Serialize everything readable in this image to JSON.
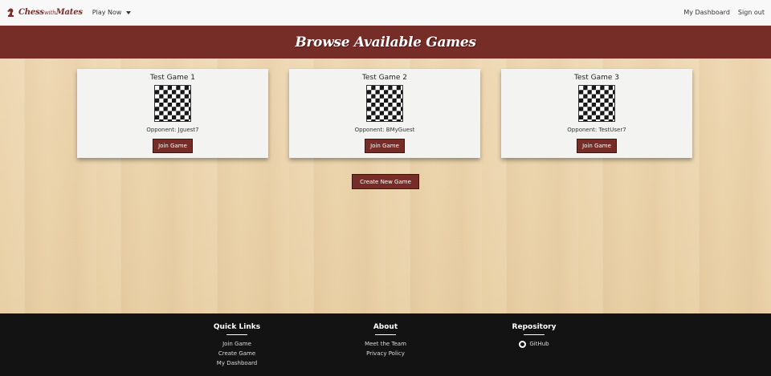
{
  "navbar": {
    "brand_main": "Chess",
    "brand_small": "with",
    "brand_end": "Mates",
    "play_now": "Play Now",
    "dashboard": "My Dashboard",
    "sign_out": "Sign out"
  },
  "banner": {
    "title": "Browse Available Games"
  },
  "games": [
    {
      "title": "Test Game 1",
      "opponent": "Opponent: Jguest7",
      "button": "Join Game"
    },
    {
      "title": "Test Game 2",
      "opponent": "Opponent: BMyGuest",
      "button": "Join Game"
    },
    {
      "title": "Test Game 3",
      "opponent": "Opponent: TestUser7",
      "button": "Join Game"
    }
  ],
  "create_button": "Create New Game",
  "footer": {
    "quick_links": {
      "heading": "Quick Links",
      "items": [
        "Join Game",
        "Create Game",
        "My Dashboard"
      ]
    },
    "about": {
      "heading": "About",
      "items": [
        "Meet the Team",
        "Privacy Policy"
      ]
    },
    "repository": {
      "heading": "Repository",
      "items": [
        "GitHub"
      ]
    }
  },
  "colors": {
    "accent": "#762c27",
    "footer_bg": "#131313",
    "wood": "#ead3ac"
  },
  "icons": {
    "brand": "chess-knight-icon",
    "repo": "github-icon",
    "dropdown": "caret-down-icon"
  }
}
